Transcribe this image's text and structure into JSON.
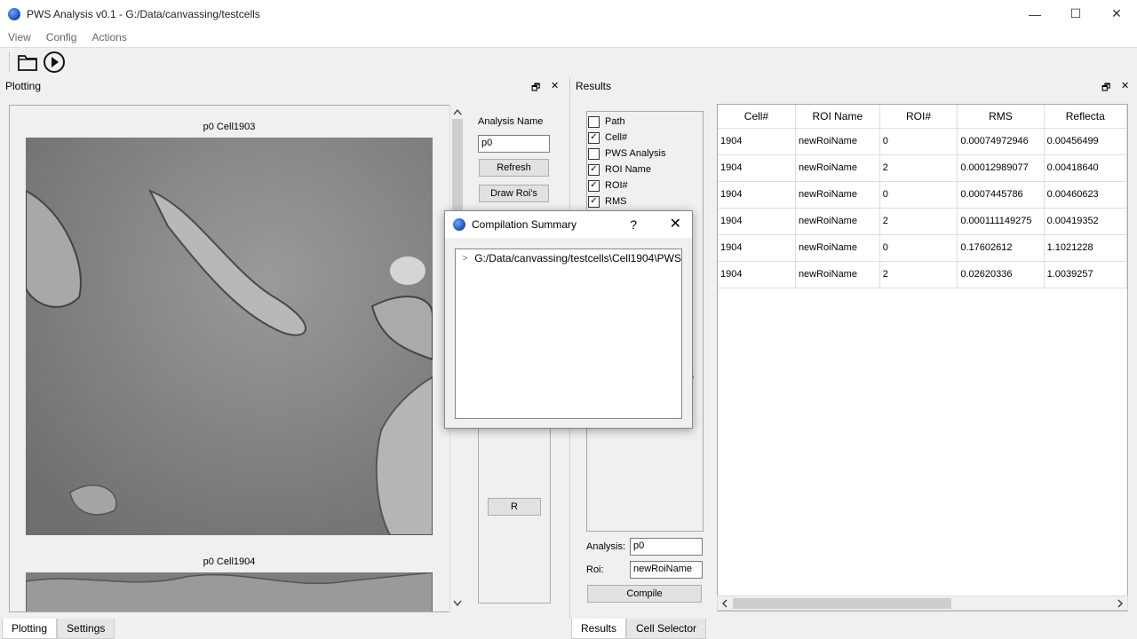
{
  "app": {
    "title": "PWS Analysis v0.1 - G:/Data/canvassing/testcells"
  },
  "menus": [
    "View",
    "Config",
    "Actions"
  ],
  "window_controls": {
    "minimize": "—",
    "maximize": "☐",
    "close": "✕"
  },
  "plotting": {
    "title": "Plotting",
    "cells": [
      {
        "label": "p0 Cell1903"
      },
      {
        "label": "p0 Cell1904"
      }
    ],
    "analysis_name_label": "Analysis Name",
    "analysis_name_value": "p0",
    "refresh_button": "Refresh",
    "draw_rois_button": "Draw Roi's",
    "r_button": "R"
  },
  "results": {
    "title": "Results",
    "checkboxes": [
      {
        "label": "Path",
        "checked": false
      },
      {
        "label": "Cell#",
        "checked": true
      },
      {
        "label": "PWS Analysis",
        "checked": false
      },
      {
        "label": "ROI Name",
        "checked": true
      },
      {
        "label": "ROI#",
        "checked": true
      },
      {
        "label": "RMS",
        "checked": true
      }
    ],
    "analysis_label": "Analysis:",
    "analysis_value": "p0",
    "roi_label": "Roi:",
    "roi_value": "newRoiName",
    "compile_button": "Compile",
    "table": {
      "columns": [
        "Cell#",
        "ROI Name",
        "ROI#",
        "RMS",
        "Reflecta"
      ],
      "rows": [
        [
          "1904",
          "newRoiName",
          "0",
          "0.00074972946",
          "0.00456499"
        ],
        [
          "1904",
          "newRoiName",
          "2",
          "0.00012989077",
          "0.00418640"
        ],
        [
          "1904",
          "newRoiName",
          "0",
          "0.0007445786",
          "0.00460623"
        ],
        [
          "1904",
          "newRoiName",
          "2",
          "0.000111149275",
          "0.00419352"
        ],
        [
          "1904",
          "newRoiName",
          "0",
          "0.17602612",
          "1.1021228"
        ],
        [
          "1904",
          "newRoiName",
          "2",
          "0.02620336",
          "1.0039257"
        ]
      ]
    }
  },
  "dialog": {
    "title": "Compilation Summary",
    "help": "?",
    "tree_item": "G:/Data/canvassing/testcells\\Cell1904\\PWS"
  },
  "bottom_tabs_left": [
    "Plotting",
    "Settings"
  ],
  "bottom_tabs_right": [
    "Results",
    "Cell Selector"
  ],
  "dock_controls": {
    "float": "🗗",
    "close": "✕"
  },
  "hidden_fragment": "e"
}
